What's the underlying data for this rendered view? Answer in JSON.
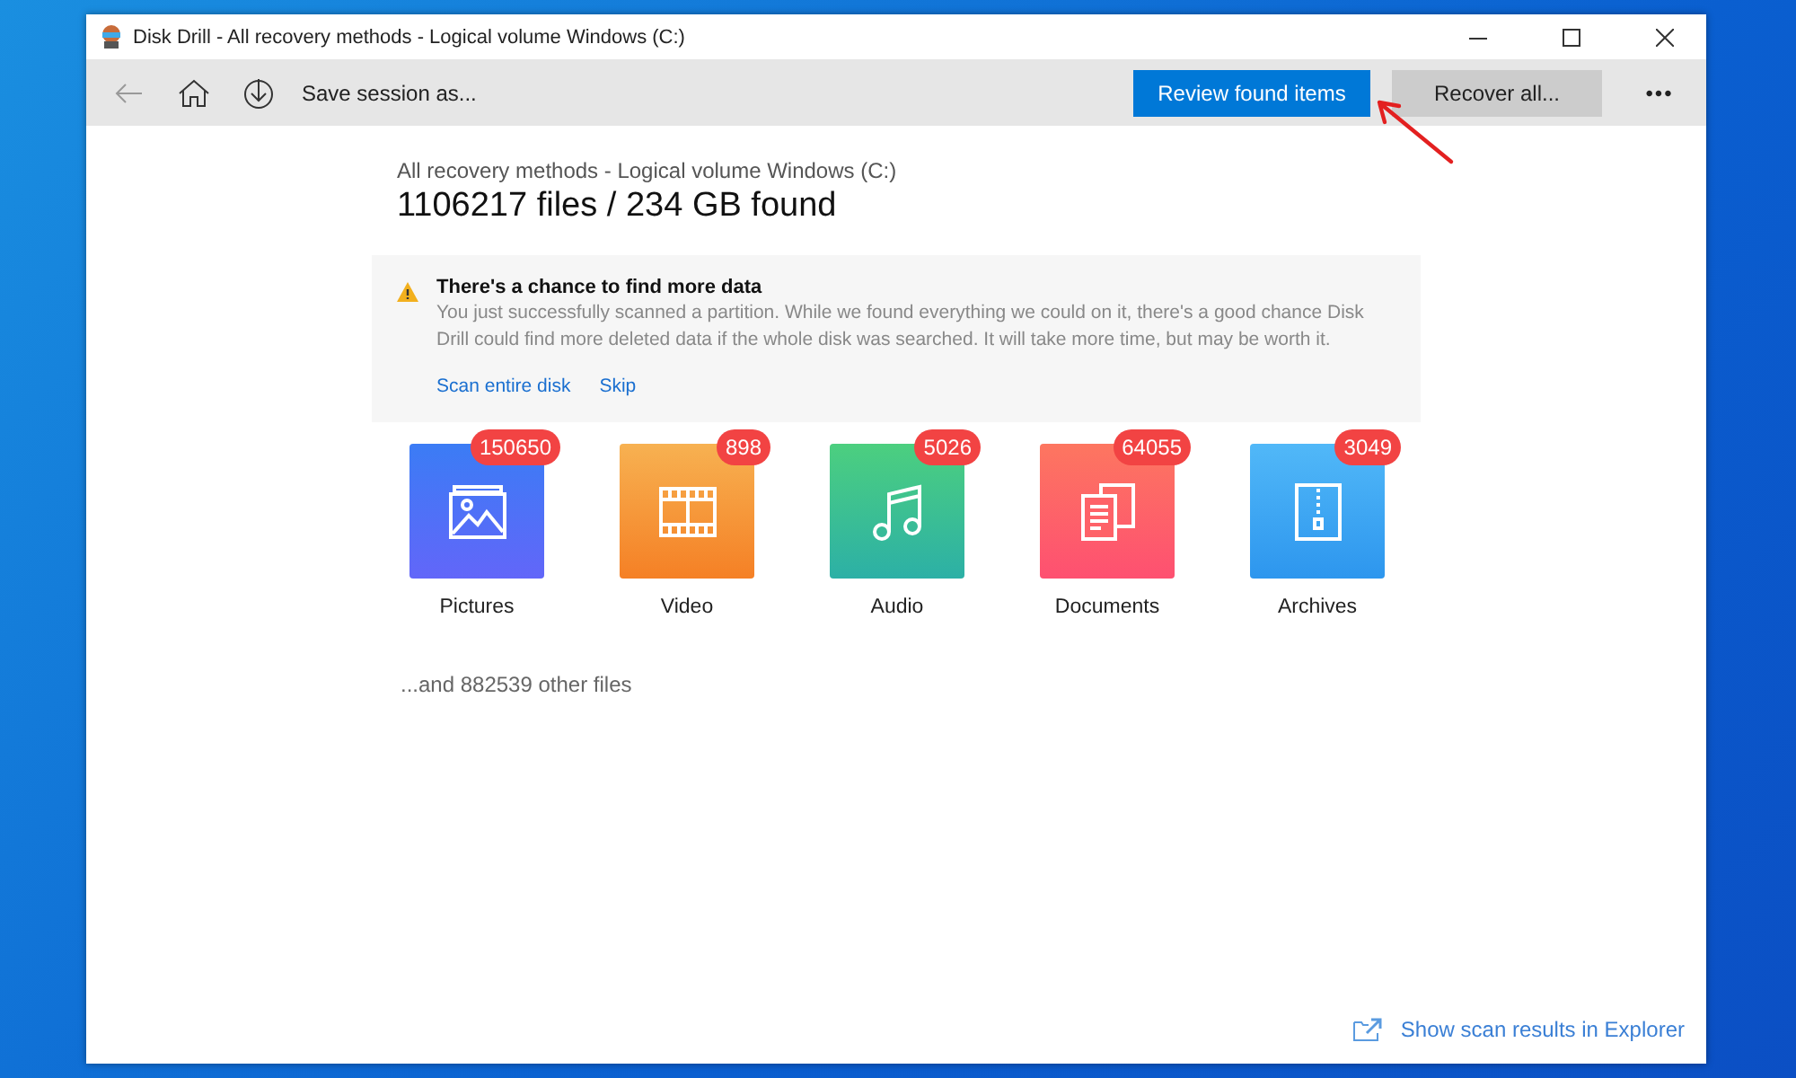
{
  "window": {
    "title": "Disk Drill - All recovery methods - Logical volume Windows (C:)"
  },
  "toolbar": {
    "save_label": "Save session as...",
    "review_button": "Review found items",
    "recover_button": "Recover all...",
    "more": "•••"
  },
  "scan": {
    "subtitle": "All recovery methods - Logical volume Windows (C:)",
    "summary": "1106217 files / 234 GB found"
  },
  "notice": {
    "title": "There's a chance to find more data",
    "body": "You just successfully scanned a partition. While we found everything we could on it, there's a good chance Disk Drill could find more deleted data if the whole disk was searched. It will take more time, but may be worth it.",
    "actions": [
      "Scan entire disk",
      "Skip"
    ]
  },
  "categories": [
    {
      "kind": "pictures",
      "label": "Pictures",
      "count": "150650"
    },
    {
      "kind": "video",
      "label": "Video",
      "count": "898"
    },
    {
      "kind": "audio",
      "label": "Audio",
      "count": "5026"
    },
    {
      "kind": "documents",
      "label": "Documents",
      "count": "64055"
    },
    {
      "kind": "archives",
      "label": "Archives",
      "count": "3049"
    }
  ],
  "other_files": "...and 882539 other files",
  "footer_link": "Show scan results in Explorer"
}
